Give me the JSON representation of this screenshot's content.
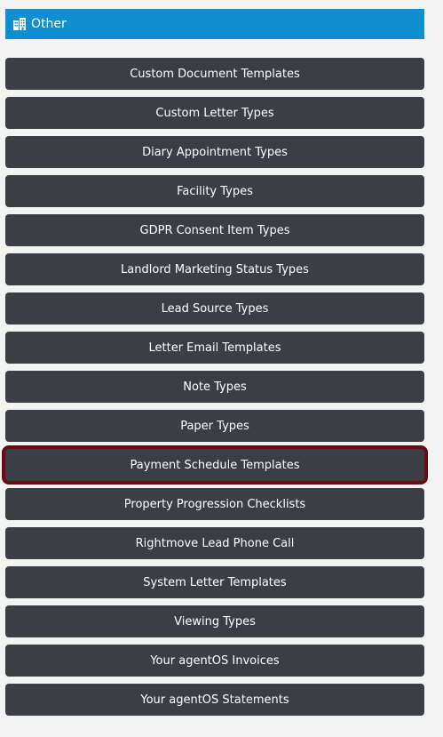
{
  "header": {
    "title": "Other",
    "icon": "building-icon",
    "color": "#0e8fd0"
  },
  "menu": {
    "button_color": "#3b3e45",
    "highlight_color": "#6e0a16",
    "items": [
      {
        "label": "Custom Document Templates"
      },
      {
        "label": "Custom Letter Types"
      },
      {
        "label": "Diary Appointment Types"
      },
      {
        "label": "Facility Types"
      },
      {
        "label": "GDPR Consent Item Types"
      },
      {
        "label": "Landlord Marketing Status Types"
      },
      {
        "label": "Lead Source Types"
      },
      {
        "label": "Letter Email Templates"
      },
      {
        "label": "Note Types"
      },
      {
        "label": "Paper Types"
      },
      {
        "label": "Payment Schedule Templates",
        "highlighted": true
      },
      {
        "label": "Property Progression Checklists"
      },
      {
        "label": "Rightmove Lead Phone Call"
      },
      {
        "label": "System Letter Templates"
      },
      {
        "label": "Viewing Types"
      },
      {
        "label": "Your agentOS Invoices"
      },
      {
        "label": "Your agentOS Statements"
      }
    ]
  }
}
